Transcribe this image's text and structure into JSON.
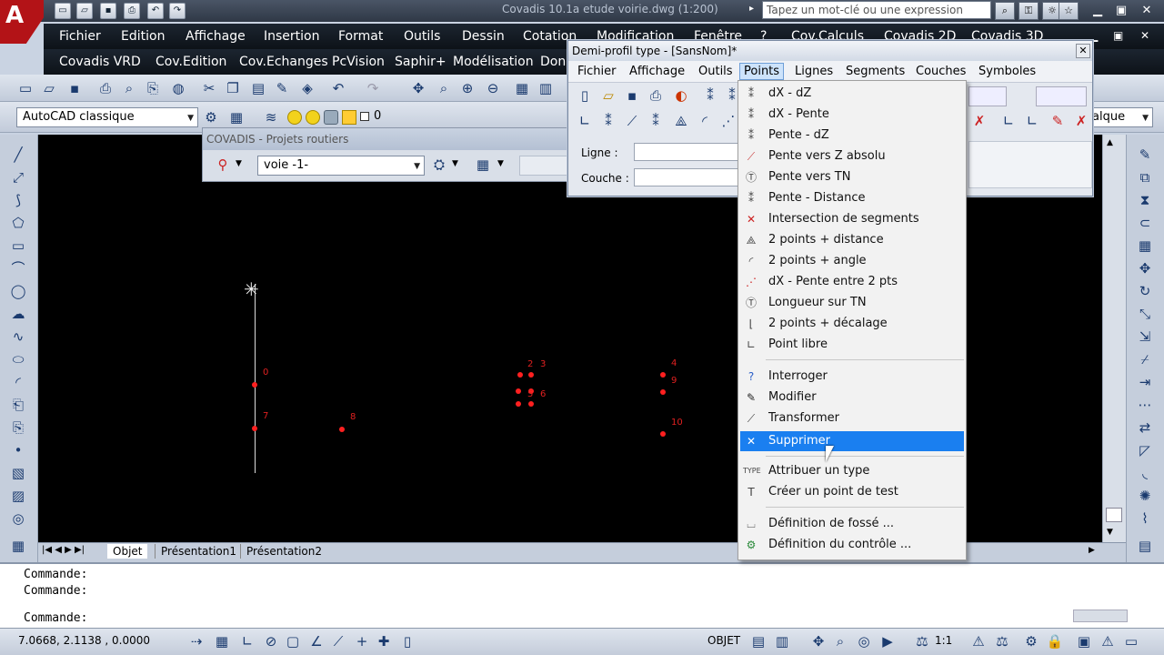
{
  "window": {
    "title": "Covadis 10.1a etude voirie.dwg (1:200)",
    "search_placeholder": "Tapez un mot-clé ou une expression"
  },
  "menubar1": [
    "Fichier",
    "Edition",
    "Affichage",
    "Insertion",
    "Format",
    "Outils",
    "Dessin",
    "Cotation",
    "Modification",
    "Fenêtre",
    "?",
    "Cov.Calculs",
    "Covadis 2D",
    "Covadis 3D"
  ],
  "menubar2": [
    "Covadis VRD",
    "Cov.Edition",
    "Cov.Echanges",
    "PcVision",
    "Saphir+",
    "Modélisation",
    "Donn"
  ],
  "workspace": {
    "name": "AutoCAD classique",
    "layer": "0",
    "right_combo": "alque"
  },
  "projets": {
    "title": "COVADIS - Projets routiers",
    "voie": "voie -1-"
  },
  "dialog": {
    "title": "Demi-profil type - [SansNom]*",
    "menu": [
      "Fichier",
      "Affichage",
      "Outils",
      "Points",
      "Lignes",
      "Segments",
      "Couches",
      "Symboles"
    ],
    "selected_menu": "Points",
    "fields": {
      "ligne_label": "Ligne :",
      "couche_label": "Couche :"
    }
  },
  "points_menu": [
    {
      "label": "dX - dZ",
      "icon": "dx-dz-icon"
    },
    {
      "label": "dX - Pente",
      "icon": "dx-slope-icon"
    },
    {
      "label": "Pente - dZ",
      "icon": "slope-dz-icon"
    },
    {
      "label": "Pente vers Z absolu",
      "icon": "slope-z-icon"
    },
    {
      "label": "Pente vers TN",
      "icon": "slope-tn-icon"
    },
    {
      "label": "Pente - Distance",
      "icon": "slope-distance-icon"
    },
    {
      "label": "Intersection de segments",
      "icon": "intersection-icon"
    },
    {
      "label": "2 points + distance",
      "icon": "two-points-distance-icon"
    },
    {
      "label": "2 points + angle",
      "icon": "two-points-angle-icon"
    },
    {
      "label": "dX - Pente entre 2 pts",
      "icon": "dx-slope-between-icon"
    },
    {
      "label": "Longueur sur TN",
      "icon": "length-tn-icon"
    },
    {
      "label": "2 points + décalage",
      "icon": "two-points-offset-icon"
    },
    {
      "label": "Point libre",
      "icon": "free-point-icon"
    },
    {
      "label": "Interroger",
      "icon": "query-icon"
    },
    {
      "label": "Modifier",
      "icon": "pencil-icon"
    },
    {
      "label": "Transformer",
      "icon": "transform-icon"
    },
    {
      "label": "Supprimer",
      "icon": "delete-icon",
      "highlighted": true
    },
    {
      "label": "Attribuer un type",
      "icon": "type-icon"
    },
    {
      "label": "Créer un point de test",
      "icon": "test-point-icon"
    },
    {
      "label": "Définition de fossé ...",
      "icon": "ditch-icon"
    },
    {
      "label": "Définition du contrôle ...",
      "icon": "gear-icon"
    }
  ],
  "drawing_points": [
    "0",
    "7",
    "8",
    "2",
    "3",
    "5",
    "6",
    "4",
    "9",
    "10"
  ],
  "layout_tabs": [
    "Objet",
    "Présentation1",
    "Présentation2"
  ],
  "command_lines": [
    "Commande:",
    "Commande:",
    "Commande:"
  ],
  "status": {
    "coords": "7.0668, 2.1138 , 0.0000",
    "objet": "OBJET",
    "scale": "1:1"
  },
  "colors": {
    "highlight": "#1a7ff0",
    "points": "#ff2020",
    "canvas": "#000000"
  }
}
